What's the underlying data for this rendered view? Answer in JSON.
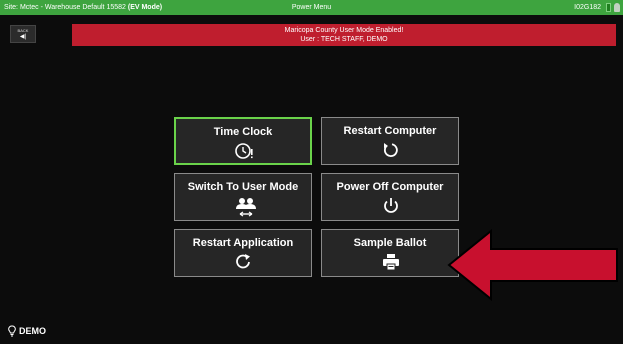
{
  "status_bar": {
    "site_prefix": "Site: Mctec - Warehouse Default 15582 ",
    "mode": "(EV Mode)",
    "title": "Power Menu",
    "device_id": "I02G182"
  },
  "back_button": {
    "label": "BACK"
  },
  "banner": {
    "line1": "Maricopa County User Mode Enabled!",
    "line2": "User : TECH STAFF, DEMO",
    "color": "#bf1e2e"
  },
  "menu": {
    "time_clock": {
      "label": "Time Clock",
      "icon": "clock-alert-icon"
    },
    "restart_computer": {
      "label": "Restart Computer",
      "icon": "restart-icon"
    },
    "switch_user_mode": {
      "label": "Switch To User Mode",
      "icon": "users-switch-icon"
    },
    "power_off": {
      "label": "Power Off Computer",
      "icon": "power-icon"
    },
    "restart_app": {
      "label": "Restart Application",
      "icon": "refresh-icon"
    },
    "sample_ballot": {
      "label": "Sample Ballot",
      "icon": "printer-icon"
    }
  },
  "footer": {
    "label": "DEMO"
  },
  "colors": {
    "accent_green": "#3ea43f",
    "active_border": "#6ad34a",
    "arrow": "#c8102e"
  }
}
